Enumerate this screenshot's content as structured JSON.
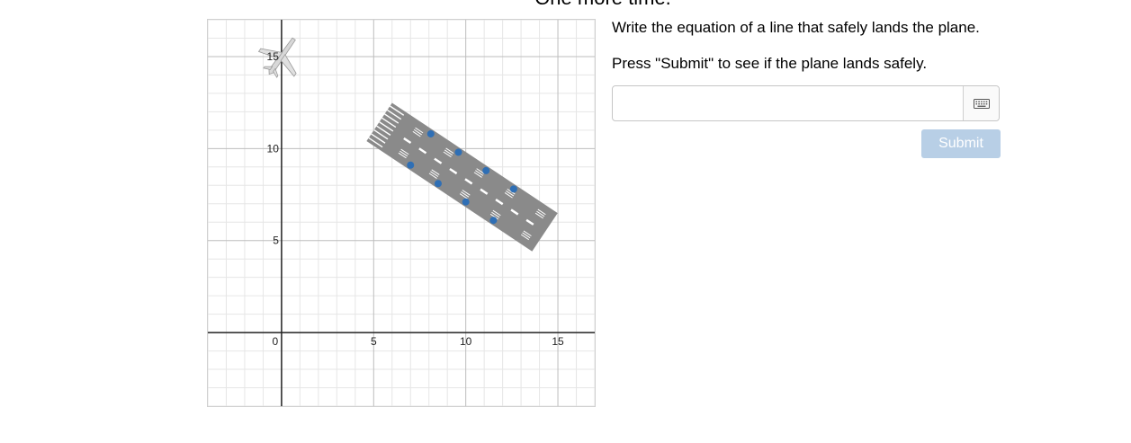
{
  "page": {
    "heading": "One more time."
  },
  "graph": {
    "x_ticks": [
      "0",
      "5",
      "10",
      "15"
    ],
    "y_ticks": [
      "5",
      "10",
      "15"
    ],
    "x_range": [
      -4,
      17
    ],
    "y_range": [
      -4,
      17
    ],
    "runway_points": [
      [
        7.0,
        9.1
      ],
      [
        8.5,
        8.1
      ],
      [
        10.0,
        7.1
      ],
      [
        11.5,
        6.1
      ],
      [
        8.1,
        10.8
      ],
      [
        9.6,
        9.8
      ],
      [
        11.1,
        8.8
      ],
      [
        12.6,
        7.8
      ]
    ],
    "colors": {
      "point": "#2f6fb5",
      "runway": "#8a8a8a",
      "grid_minor": "#e6e6e6",
      "grid_major": "#bdbdbd",
      "axis": "#222222"
    }
  },
  "prompt": {
    "line1": "Write the equation of a line that safely lands the plane.",
    "line2": "Press \"Submit\" to see if the plane lands safely."
  },
  "answer": {
    "value": "",
    "keyboard_icon": "keyboard-icon"
  },
  "submit": {
    "label": "Submit",
    "color": "#b8cfe6"
  }
}
